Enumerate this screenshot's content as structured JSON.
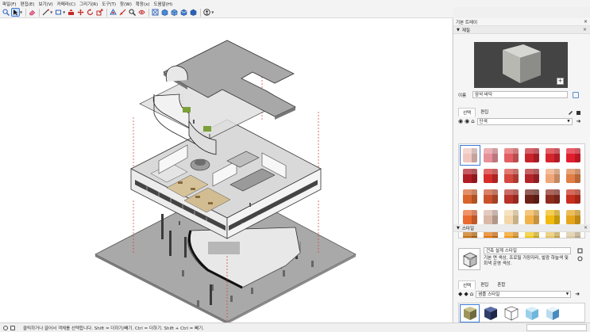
{
  "menu": [
    "파일(F)",
    "편집(E)",
    "보기(V)",
    "카메라(C)",
    "그리기(R)",
    "도구(T)",
    "창(W)",
    "확장(x)",
    "도움말(H)"
  ],
  "toolbar": {
    "icons": [
      "zoom-icon",
      "select-icon",
      "eraser-icon",
      "line-icon",
      "rectangle-icon",
      "push-pull-icon",
      "move-icon",
      "rotate-icon",
      "scale-icon",
      "offset-icon",
      "tape-icon",
      "text-icon",
      "zoom-window-icon",
      "zoom-extents-icon",
      "previous-view-icon",
      "iso-view-icon",
      "top-view-icon",
      "front-view-icon",
      "user-icon"
    ]
  },
  "tray": {
    "title": "기본 트레이",
    "materials": {
      "header": "재질",
      "name_label": "이름",
      "name_value": "암석 바닥",
      "tabs": [
        "선택",
        "편집"
      ],
      "library": "단색",
      "swatch_colors": [
        "#f0c7c0",
        "#e6909a",
        "#e35d62",
        "#c8232b",
        "#d6242c",
        "#e21d2d",
        "#b01e24",
        "#d42d2a",
        "#d4473e",
        "#b32429",
        "#f0a678",
        "#e07e45",
        "#d9652c",
        "#c9512c",
        "#b8322a",
        "#6e2118",
        "#8e2c1e",
        "#c7301d",
        "#ea6b2f",
        "#d9b8a8",
        "#f3d7a8",
        "#f2b24a",
        "#f0ba10",
        "#e5a61c",
        "#c8700e",
        "#e2760d",
        "#f19c17",
        "#f0c61b",
        "#e8c35f",
        "#dcc7a0"
      ]
    },
    "styles": {
      "header": "스타일",
      "name_value": "건축 설계 스타일",
      "description": "기본 면 색상, 프로필 가장자리, 발광 하늘색 및 회색 운영 색상.",
      "tabs": [
        "선택",
        "편집",
        "혼합"
      ],
      "library": "샘플 스타일"
    }
  },
  "status": {
    "hint": "클릭하거나 끌어서 객체를 선택합니다. Shift = 더하기/빼기. Ctrl = 더하기. Shift + Ctrl = 빼기."
  }
}
